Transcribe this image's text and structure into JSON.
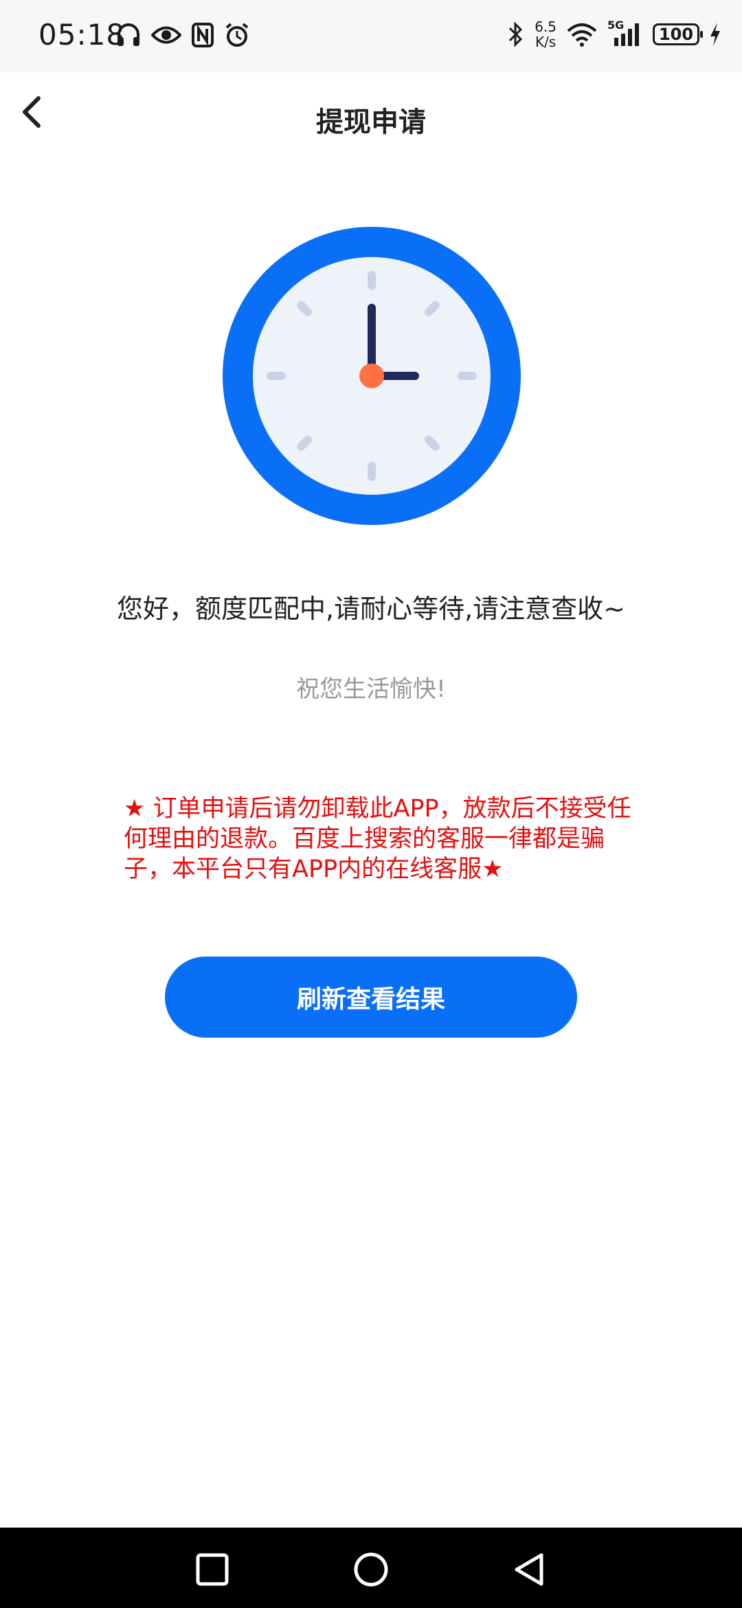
{
  "status_bar": {
    "time": "05:18",
    "net_speed_value": "6.5",
    "net_speed_unit": "K/s",
    "network": "5G",
    "battery": "100"
  },
  "nav": {
    "title": "提现申请",
    "back_icon": "chevron-left-icon"
  },
  "main": {
    "message": "您好，额度匹配中,请耐心等待,请注意查收~",
    "wish": "祝您生活愉快!",
    "warning": "★ 订单申请后请勿卸载此APP，放款后不接受任何理由的退款。百度上搜索的客服一律都是骗子，本平台只有APP内的在线客服★",
    "refresh_label": "刷新查看结果"
  },
  "colors": {
    "accent": "#0a6ff7",
    "warning": "#e41010",
    "clock_hand": "#1e2a5a",
    "clock_center": "#ff7043"
  }
}
